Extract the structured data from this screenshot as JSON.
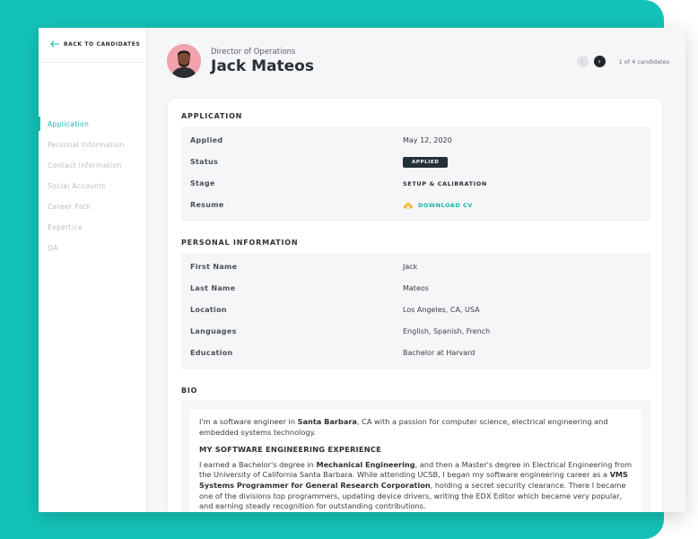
{
  "nav": {
    "back_label": "BACK TO CANDIDATES",
    "items": [
      {
        "label": "Application"
      },
      {
        "label": "Personal Information"
      },
      {
        "label": "Contact Information"
      },
      {
        "label": "Social Accounts"
      },
      {
        "label": "Career Path"
      },
      {
        "label": "Expertice"
      },
      {
        "label": "QA"
      }
    ],
    "active_index": 0
  },
  "candidate": {
    "role": "Director of Operations",
    "name": "Jack Mateos"
  },
  "pager": {
    "count_text": "1 of 4 candidates",
    "prev_icon": "chevron-left-icon",
    "next_icon": "chevron-right-icon"
  },
  "application": {
    "title": "APPLICATION",
    "rows": {
      "applied": {
        "label": "Applied",
        "value": "May 12, 2020"
      },
      "status": {
        "label": "Status",
        "value": "APPLIED"
      },
      "stage": {
        "label": "Stage",
        "value": "SETUP & CALIBRATION"
      },
      "resume": {
        "label": "Resume",
        "value": "DOWNLOAD CV"
      }
    }
  },
  "personal": {
    "title": "PERSONAL INFORMATION",
    "rows": [
      {
        "label": "First Name",
        "value": "Jack"
      },
      {
        "label": "Last Name",
        "value": "Mateos"
      },
      {
        "label": "Location",
        "value": "Los Angeles, CA, USA"
      },
      {
        "label": "Languages",
        "value": "English, Spanish, French"
      },
      {
        "label": "Education",
        "value": "Bachelor at Harvard"
      }
    ]
  },
  "bio": {
    "title": "BIO",
    "intro": {
      "a": "I'm a software engineer in ",
      "b": "Santa Barbara",
      "c": ", CA with a passion for computer science, electrical engineering and embedded systems technology."
    },
    "heading": "MY SOFTWARE ENGINEERING EXPERIENCE",
    "para": {
      "a": "I earned a Bachelor's degree in ",
      "b": "Mechanical Engineering",
      "c": ", and then a Master's degree in Electrical Engineering from the University of California Santa Barbara. While attending UCSB, I began my software engineering career as a ",
      "d": "VMS Systems Programmer for General Research Corporation",
      "e": ", holding a secret security clearance. There I became one of the divisions top programmers, updating device drivers, writing the EDX Editor which became very popular, and earning steady recognition for outstanding contributions."
    }
  },
  "colors": {
    "accent": "#14b5ab",
    "background": "#14c3b8",
    "dark": "#243038"
  }
}
